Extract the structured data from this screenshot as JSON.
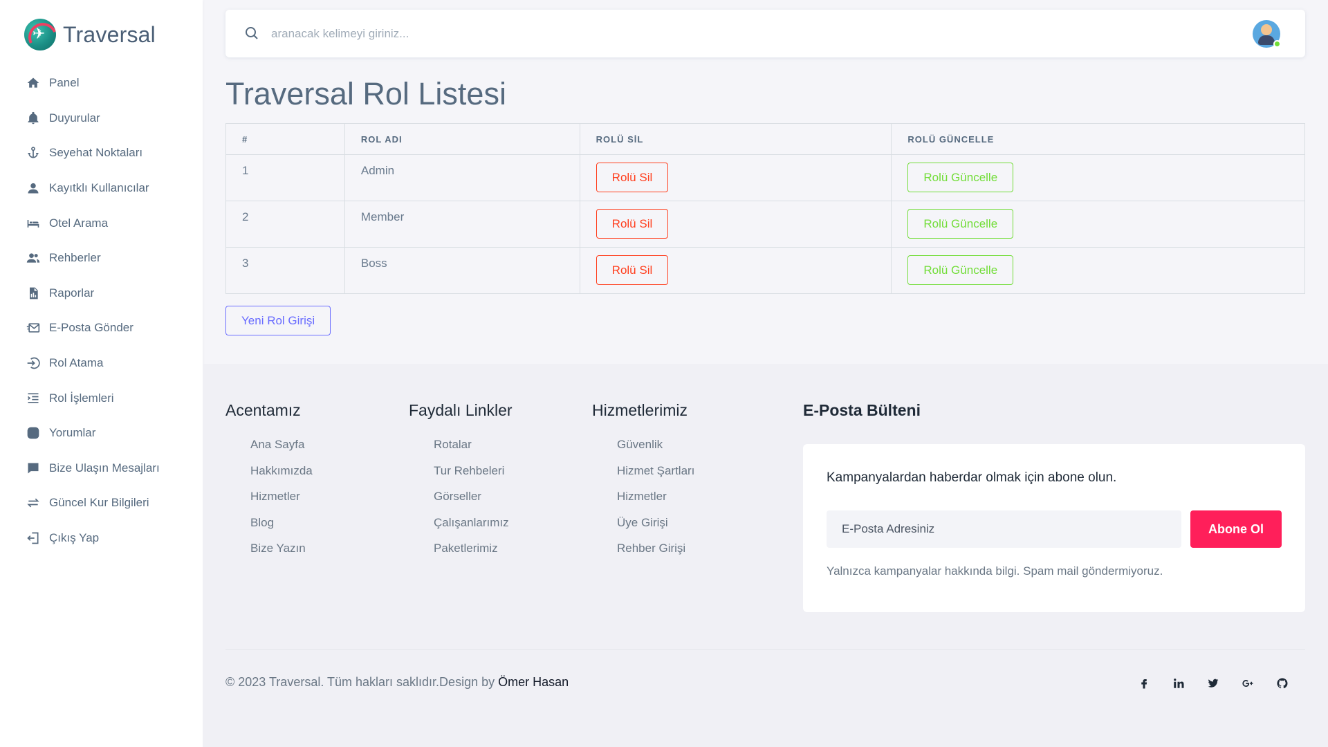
{
  "brand": {
    "name": "Traversal"
  },
  "sidebar": {
    "items": [
      {
        "label": "Panel",
        "icon": "home-icon"
      },
      {
        "label": "Duyurular",
        "icon": "bell-icon"
      },
      {
        "label": "Seyehat Noktaları",
        "icon": "anchor-icon"
      },
      {
        "label": "Kayıtklı Kullanıcılar",
        "icon": "user-icon"
      },
      {
        "label": "Otel Arama",
        "icon": "bed-icon"
      },
      {
        "label": "Rehberler",
        "icon": "users-icon"
      },
      {
        "label": "Raporlar",
        "icon": "report-icon"
      },
      {
        "label": "E-Posta Gönder",
        "icon": "mail-send-icon"
      },
      {
        "label": "Rol Atama",
        "icon": "log-in-icon"
      },
      {
        "label": "Rol İşlemleri",
        "icon": "list-indent-icon"
      },
      {
        "label": "Yorumlar",
        "icon": "comment-icon"
      },
      {
        "label": "Bize Ulaşın Mesajları",
        "icon": "message-icon"
      },
      {
        "label": "Güncel Kur Bilgileri",
        "icon": "transfer-icon"
      },
      {
        "label": "Çıkış Yap",
        "icon": "log-out-icon"
      }
    ]
  },
  "search": {
    "placeholder": "aranacak kelimeyi giriniz..."
  },
  "page": {
    "title": "Traversal Rol Listesi"
  },
  "table": {
    "headers": [
      "#",
      "ROL ADI",
      "ROLÜ SİL",
      "ROLÜ GÜNCELLE"
    ],
    "rows": [
      {
        "id": "1",
        "name": "Admin",
        "delete_label": "Rolü Sil",
        "update_label": "Rolü Güncelle"
      },
      {
        "id": "2",
        "name": "Member",
        "delete_label": "Rolü Sil",
        "update_label": "Rolü Güncelle"
      },
      {
        "id": "3",
        "name": "Boss",
        "delete_label": "Rolü Sil",
        "update_label": "Rolü Güncelle"
      }
    ]
  },
  "new_role_button": "Yeni Rol Girişi",
  "footer": {
    "columns": [
      {
        "title": "Acentamız",
        "links": [
          "Ana Sayfa",
          "Hakkımızda",
          "Hizmetler",
          "Blog",
          "Bize Yazın"
        ]
      },
      {
        "title": "Faydalı Linkler",
        "links": [
          "Rotalar",
          "Tur Rehbeleri",
          "Görseller",
          "Çalışanlarımız",
          "Paketlerimiz"
        ]
      },
      {
        "title": "Hizmetlerimiz",
        "links": [
          "Güvenlik",
          "Hizmet Şartları",
          "Hizmetler",
          "Üye Girişi",
          "Rehber Girişi"
        ]
      }
    ],
    "newsletter": {
      "title": "E-Posta Bülteni",
      "text": "Kampanyalardan haberdar olmak için abone olun.",
      "input_placeholder": "E-Posta Adresiniz",
      "button": "Abone Ol",
      "note": "Yalnızca kampanyalar hakkında bilgi. Spam mail göndermiyoruz."
    },
    "copyright": "© 2023 Traversal. Tüm hakları saklıdır.Design by ",
    "author": "Ömer Hasan",
    "socials": [
      "facebook-icon",
      "linkedin-icon",
      "twitter-icon",
      "google-plus-icon",
      "github-icon"
    ]
  },
  "colors": {
    "danger": "#ff3e1d",
    "success": "#71dd37",
    "primary": "#696cff",
    "subscribe": "#ff1f5a"
  }
}
